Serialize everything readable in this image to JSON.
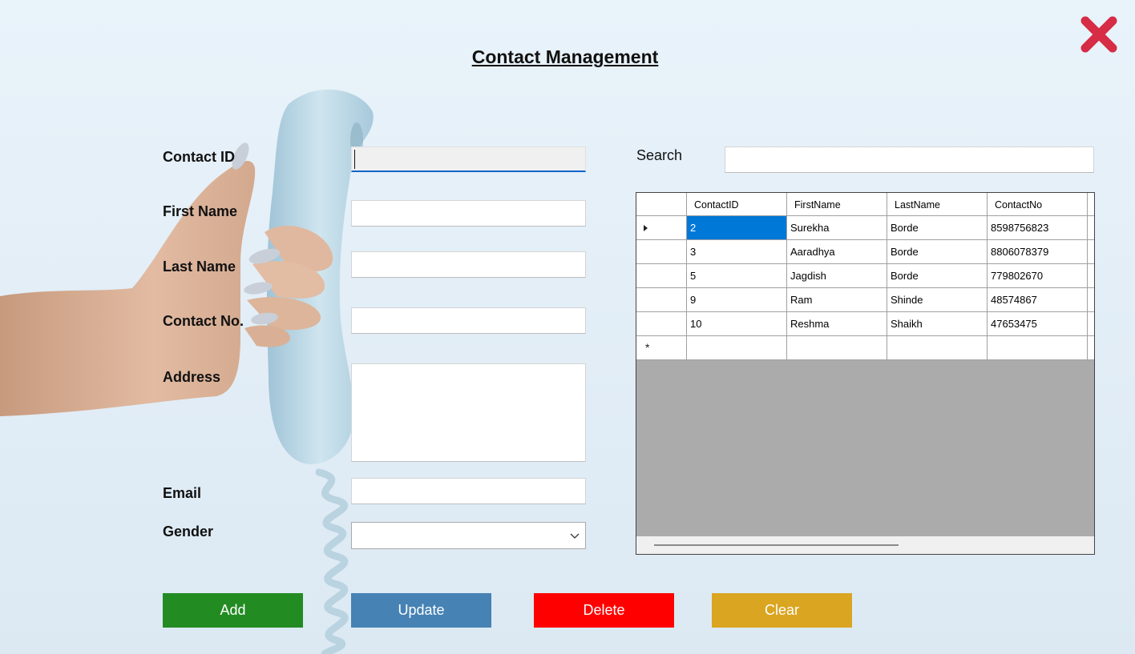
{
  "title": "Contact Management",
  "form": {
    "contact_id_label": "Contact ID",
    "first_name_label": "First Name",
    "last_name_label": "Last Name",
    "contact_no_label": "Contact No.",
    "address_label": "Address",
    "email_label": "Email",
    "gender_label": "Gender",
    "contact_id_value": "",
    "first_name_value": "",
    "last_name_value": "",
    "contact_no_value": "",
    "address_value": "",
    "email_value": "",
    "gender_value": ""
  },
  "search": {
    "label": "Search",
    "value": ""
  },
  "grid": {
    "columns": [
      "ContactID",
      "FirstName",
      "LastName",
      "ContactNo"
    ],
    "rows": [
      [
        "2",
        "Surekha",
        "Borde",
        "8598756823"
      ],
      [
        "3",
        "Aaradhya",
        "Borde",
        "8806078379"
      ],
      [
        "5",
        "Jagdish",
        "Borde",
        "779802670"
      ],
      [
        "9",
        "Ram",
        "Shinde",
        "48574867"
      ],
      [
        "10",
        "Reshma",
        "Shaikh",
        "47653475"
      ]
    ],
    "selected_row": 0,
    "new_row_marker": "*"
  },
  "buttons": {
    "add": "Add",
    "update": "Update",
    "delete": "Delete",
    "clear": "Clear"
  },
  "colors": {
    "add": "#228b22",
    "update": "#4682b4",
    "delete": "#ff0000",
    "clear": "#daa520",
    "close": "#d62c45",
    "selection": "#0078d7"
  },
  "icons": {
    "close": "close-icon",
    "dropdown": "chevron-down-icon",
    "row_pointer": "row-pointer-icon"
  }
}
